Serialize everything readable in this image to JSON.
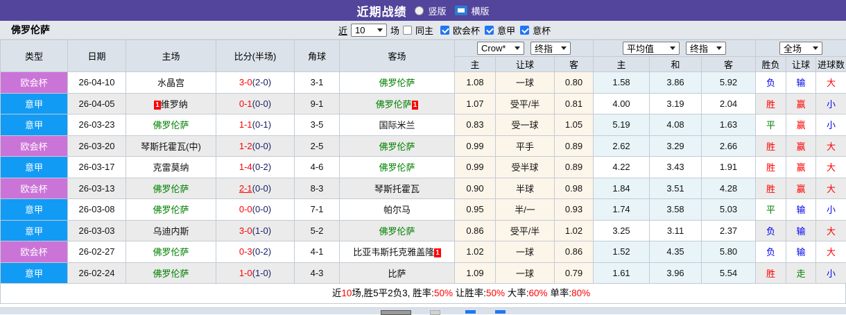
{
  "title_bar": {
    "title": "近期战绩",
    "radio_vertical_label": "竖版",
    "radio_horizontal_label": "横版",
    "selected": "横版"
  },
  "filter_bar": {
    "team": "佛罗伦萨",
    "near_label": "近",
    "count_value": "10",
    "games_label": "场",
    "same_home_label": "同主",
    "cup_labels": [
      "欧会杯",
      "意甲",
      "意杯"
    ],
    "same_home_checked": false,
    "cups_checked": [
      true,
      true,
      true
    ]
  },
  "table": {
    "headers": {
      "type": "类型",
      "date": "日期",
      "home": "主场",
      "score": "比分(半场)",
      "corner": "角球",
      "away": "客场",
      "odds_book": "Crow*",
      "odds_index": "终指",
      "avg_book": "平均值",
      "avg_index": "终指",
      "scope": "全场",
      "sub": [
        "主",
        "让球",
        "客",
        "主",
        "和",
        "客",
        "胜负",
        "让球",
        "进球数"
      ]
    },
    "rows": [
      {
        "league": "欧会杯",
        "date": "26-04-10",
        "home": "水晶宫",
        "home_fio": false,
        "home_card": "",
        "score": "3-0",
        "half": "(2-0)",
        "score_underline": false,
        "corner": "3-1",
        "away": "佛罗伦萨",
        "away_fio": true,
        "away_card": "",
        "o1": "1.08",
        "handicap": "一球",
        "o2": "0.80",
        "a1": "1.58",
        "a2": "3.86",
        "a3": "5.92",
        "avg_blue": true,
        "r1": "负",
        "r2": "输",
        "r3": "大"
      },
      {
        "league": "意甲",
        "date": "26-04-05",
        "home": "维罗纳",
        "home_fio": false,
        "home_card": "1",
        "score": "0-1",
        "half": "(0-0)",
        "score_underline": false,
        "corner": "9-1",
        "away": "佛罗伦萨",
        "away_fio": true,
        "away_card": "1",
        "o1": "1.07",
        "handicap": "受平/半",
        "o2": "0.81",
        "a1": "4.00",
        "a2": "3.19",
        "a3": "2.04",
        "avg_blue": false,
        "r1": "胜",
        "r2": "赢",
        "r3": "小"
      },
      {
        "league": "意甲",
        "date": "26-03-23",
        "home": "佛罗伦萨",
        "home_fio": true,
        "home_card": "",
        "score": "1-1",
        "half": "(0-1)",
        "score_underline": false,
        "corner": "3-5",
        "away": "国际米兰",
        "away_fio": false,
        "away_card": "",
        "o1": "0.83",
        "handicap": "受一球",
        "o2": "1.05",
        "a1": "5.19",
        "a2": "4.08",
        "a3": "1.63",
        "avg_blue": true,
        "r1": "平",
        "r2": "赢",
        "r3": "小"
      },
      {
        "league": "欧会杯",
        "date": "26-03-20",
        "home": "琴斯托霍瓦(中)",
        "home_fio": false,
        "home_card": "",
        "score": "1-2",
        "half": "(0-0)",
        "score_underline": false,
        "corner": "2-5",
        "away": "佛罗伦萨",
        "away_fio": true,
        "away_card": "",
        "o1": "0.99",
        "handicap": "平手",
        "o2": "0.89",
        "a1": "2.62",
        "a2": "3.29",
        "a3": "2.66",
        "avg_blue": true,
        "r1": "胜",
        "r2": "赢",
        "r3": "大"
      },
      {
        "league": "意甲",
        "date": "26-03-17",
        "home": "克雷莫纳",
        "home_fio": false,
        "home_card": "",
        "score": "1-4",
        "half": "(0-2)",
        "score_underline": false,
        "corner": "4-6",
        "away": "佛罗伦萨",
        "away_fio": true,
        "away_card": "",
        "o1": "0.99",
        "handicap": "受半球",
        "o2": "0.89",
        "a1": "4.22",
        "a2": "3.43",
        "a3": "1.91",
        "avg_blue": false,
        "r1": "胜",
        "r2": "赢",
        "r3": "大"
      },
      {
        "league": "欧会杯",
        "date": "26-03-13",
        "home": "佛罗伦萨",
        "home_fio": true,
        "home_card": "",
        "score": "2-1",
        "half": "(0-0)",
        "score_underline": true,
        "corner": "8-3",
        "away": "琴斯托霍瓦",
        "away_fio": false,
        "away_card": "",
        "o1": "0.90",
        "handicap": "半球",
        "o2": "0.98",
        "a1": "1.84",
        "a2": "3.51",
        "a3": "4.28",
        "avg_blue": true,
        "r1": "胜",
        "r2": "赢",
        "r3": "大"
      },
      {
        "league": "意甲",
        "date": "26-03-08",
        "home": "佛罗伦萨",
        "home_fio": true,
        "home_card": "",
        "score": "0-0",
        "half": "(0-0)",
        "score_underline": false,
        "corner": "7-1",
        "away": "帕尔马",
        "away_fio": false,
        "away_card": "",
        "o1": "0.95",
        "handicap": "半/一",
        "o2": "0.93",
        "a1": "1.74",
        "a2": "3.58",
        "a3": "5.03",
        "avg_blue": true,
        "r1": "平",
        "r2": "输",
        "r3": "小"
      },
      {
        "league": "意甲",
        "date": "26-03-03",
        "home": "乌迪内斯",
        "home_fio": false,
        "home_card": "",
        "score": "3-0",
        "half": "(1-0)",
        "score_underline": false,
        "corner": "5-2",
        "away": "佛罗伦萨",
        "away_fio": true,
        "away_card": "",
        "o1": "0.86",
        "handicap": "受平/半",
        "o2": "1.02",
        "a1": "3.25",
        "a2": "3.11",
        "a3": "2.37",
        "avg_blue": false,
        "r1": "负",
        "r2": "输",
        "r3": "大"
      },
      {
        "league": "欧会杯",
        "date": "26-02-27",
        "home": "佛罗伦萨",
        "home_fio": true,
        "home_card": "",
        "score": "0-3",
        "half": "(0-2)",
        "score_underline": false,
        "corner": "4-1",
        "away": "比亚韦斯托克雅盖隆",
        "away_fio": false,
        "away_card": "1",
        "o1": "1.02",
        "handicap": "一球",
        "o2": "0.86",
        "a1": "1.52",
        "a2": "4.35",
        "a3": "5.80",
        "avg_blue": true,
        "r1": "负",
        "r2": "输",
        "r3": "大"
      },
      {
        "league": "意甲",
        "date": "26-02-24",
        "home": "佛罗伦萨",
        "home_fio": true,
        "home_card": "",
        "score": "1-0",
        "half": "(1-0)",
        "score_underline": false,
        "corner": "4-3",
        "away": "比萨",
        "away_fio": false,
        "away_card": "",
        "o1": "1.09",
        "handicap": "一球",
        "o2": "0.79",
        "a1": "1.61",
        "a2": "3.96",
        "a3": "5.54",
        "avg_blue": true,
        "r1": "胜",
        "r2": "走",
        "r3": "小"
      }
    ]
  },
  "summary": {
    "segments": [
      {
        "text": "近",
        "red": false
      },
      {
        "text": "10",
        "red": true
      },
      {
        "text": "场,胜5平2负3, 胜率:",
        "red": false
      },
      {
        "text": "50%",
        "red": true
      },
      {
        "text": " 让胜率:",
        "red": false
      },
      {
        "text": "50%",
        "red": true
      },
      {
        "text": " 大率:",
        "red": false
      },
      {
        "text": "60%",
        "red": true
      },
      {
        "text": " 单率:",
        "red": false
      },
      {
        "text": "80%",
        "red": true
      }
    ]
  },
  "colors": {
    "purple_bar": "#52459B",
    "league_cup": "#CB74D8",
    "league_serie": "#119BF5",
    "team_green": "#008000",
    "score_red": "#FF0000",
    "half_navy": "#1A2066",
    "result_map": {
      "胜": "#FF0000",
      "平": "#008000",
      "负": "#0000EE",
      "赢": "#FF0000",
      "输": "#0000EE",
      "走": "#008000",
      "大": "#FF0000",
      "小": "#0000EE"
    }
  }
}
